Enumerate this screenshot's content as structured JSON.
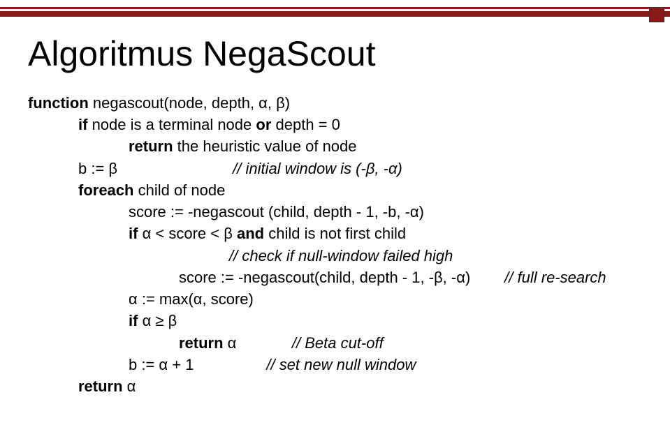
{
  "title": "Algoritmus NegaScout",
  "code": {
    "l1a": "function",
    "l1b": " negascout(node, depth, α, β)",
    "l2a": "if",
    "l2b": " node is a terminal node ",
    "l2c": "or",
    "l2d": " depth = 0",
    "l3a": "return",
    "l3b": " the heuristic value of node",
    "l4a": "b := β                           ",
    "l4b": "// initial window is (-β, -α)",
    "l5a": "foreach",
    "l5b": " child of node",
    "l6": "score := -negascout (child, depth - 1, -b, -α)",
    "l7a": "if",
    "l7b": " α < score < β ",
    "l7c": "and",
    "l7d": " child is not first child",
    "l8": "// check if null-window failed high",
    "l9a": "score := -negascout(child, depth - 1, -β, -α)        ",
    "l9b": "// full re-search",
    "l10": "α := max(α, score)",
    "l11a": "if",
    "l11b": " α ≥ β",
    "l12a": "return",
    "l12b": " α             ",
    "l12c": "// Beta cut-off",
    "l13a": "b := α + 1                 ",
    "l13b": "// set new null window",
    "l14a": "return",
    "l14b": " α"
  }
}
